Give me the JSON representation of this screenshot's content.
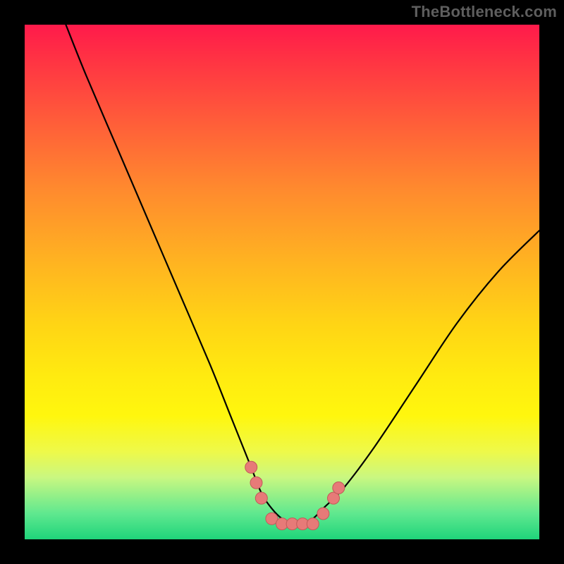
{
  "watermark": "TheBottleneck.com",
  "chart_data": {
    "type": "line",
    "title": "",
    "xlabel": "",
    "ylabel": "",
    "xlim": [
      0,
      100
    ],
    "ylim": [
      0,
      100
    ],
    "series": [
      {
        "name": "curve",
        "x": [
          8,
          12,
          18,
          24,
          30,
          36,
          40,
          44,
          46,
          48,
          50,
          52,
          54,
          56,
          58,
          62,
          68,
          76,
          84,
          92,
          100
        ],
        "y": [
          100,
          90,
          76,
          62,
          48,
          34,
          24,
          14,
          9,
          6,
          4,
          3,
          3,
          4,
          6,
          10,
          18,
          30,
          42,
          52,
          60
        ]
      }
    ],
    "markers": {
      "name": "dots",
      "points": [
        {
          "x": 44,
          "y": 14
        },
        {
          "x": 45,
          "y": 11
        },
        {
          "x": 46,
          "y": 8
        },
        {
          "x": 48,
          "y": 4
        },
        {
          "x": 50,
          "y": 3
        },
        {
          "x": 52,
          "y": 3
        },
        {
          "x": 54,
          "y": 3
        },
        {
          "x": 56,
          "y": 3
        },
        {
          "x": 58,
          "y": 5
        },
        {
          "x": 60,
          "y": 8
        },
        {
          "x": 61,
          "y": 10
        }
      ]
    },
    "colors": {
      "curve": "#000000",
      "markers_fill": "#e77a78",
      "markers_stroke": "#c15b59"
    }
  }
}
